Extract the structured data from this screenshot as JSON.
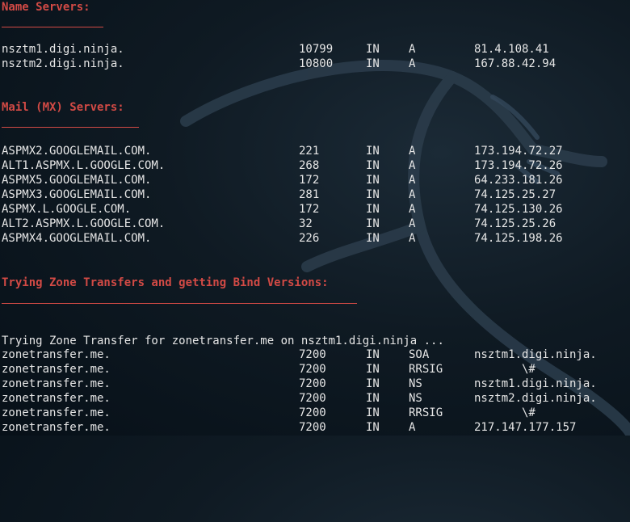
{
  "terminal": {
    "sections": {
      "name_servers": {
        "heading": "Name Servers:",
        "rows": [
          {
            "name": "nsztm1.digi.ninja.",
            "ttl": "10799",
            "class": "IN",
            "type": "A",
            "value": "81.4.108.41"
          },
          {
            "name": "nsztm2.digi.ninja.",
            "ttl": "10800",
            "class": "IN",
            "type": "A",
            "value": "167.88.42.94"
          }
        ]
      },
      "mx_servers": {
        "heading": "Mail (MX) Servers:",
        "rows": [
          {
            "name": "ASPMX2.GOOGLEMAIL.COM.",
            "ttl": "221",
            "class": "IN",
            "type": "A",
            "value": "173.194.72.27"
          },
          {
            "name": "ALT1.ASPMX.L.GOOGLE.COM.",
            "ttl": "268",
            "class": "IN",
            "type": "A",
            "value": "173.194.72.26"
          },
          {
            "name": "ASPMX5.GOOGLEMAIL.COM.",
            "ttl": "172",
            "class": "IN",
            "type": "A",
            "value": "64.233.181.26"
          },
          {
            "name": "ASPMX3.GOOGLEMAIL.COM.",
            "ttl": "281",
            "class": "IN",
            "type": "A",
            "value": "74.125.25.27"
          },
          {
            "name": "ASPMX.L.GOOGLE.COM.",
            "ttl": "172",
            "class": "IN",
            "type": "A",
            "value": "74.125.130.26"
          },
          {
            "name": "ALT2.ASPMX.L.GOOGLE.COM.",
            "ttl": "32",
            "class": "IN",
            "type": "A",
            "value": "74.125.25.26"
          },
          {
            "name": "ASPMX4.GOOGLEMAIL.COM.",
            "ttl": "226",
            "class": "IN",
            "type": "A",
            "value": "74.125.198.26"
          }
        ]
      },
      "zone_transfers": {
        "heading": "Trying Zone Transfers and getting Bind Versions:",
        "attempt_text": "Trying Zone Transfer for zonetransfer.me on nsztm1.digi.ninja ...",
        "rows": [
          {
            "name": "zonetransfer.me.",
            "ttl": "7200",
            "class": "IN",
            "type": "SOA",
            "value": "nsztm1.digi.ninja."
          },
          {
            "name": "zonetransfer.me.",
            "ttl": "7200",
            "class": "IN",
            "type": "RRSIG",
            "value": "       \\#"
          },
          {
            "name": "zonetransfer.me.",
            "ttl": "7200",
            "class": "IN",
            "type": "NS",
            "value": "nsztm1.digi.ninja."
          },
          {
            "name": "zonetransfer.me.",
            "ttl": "7200",
            "class": "IN",
            "type": "NS",
            "value": "nsztm2.digi.ninja."
          },
          {
            "name": "zonetransfer.me.",
            "ttl": "7200",
            "class": "IN",
            "type": "RRSIG",
            "value": "       \\#"
          },
          {
            "name": "zonetransfer.me.",
            "ttl": "7200",
            "class": "IN",
            "type": "A",
            "value": "217.147.177.157"
          }
        ]
      }
    },
    "colors": {
      "heading": "#d24a45",
      "text": "#e6e6e6",
      "background": "#0f1a23"
    },
    "background_icon": "kali-dragon-icon"
  }
}
